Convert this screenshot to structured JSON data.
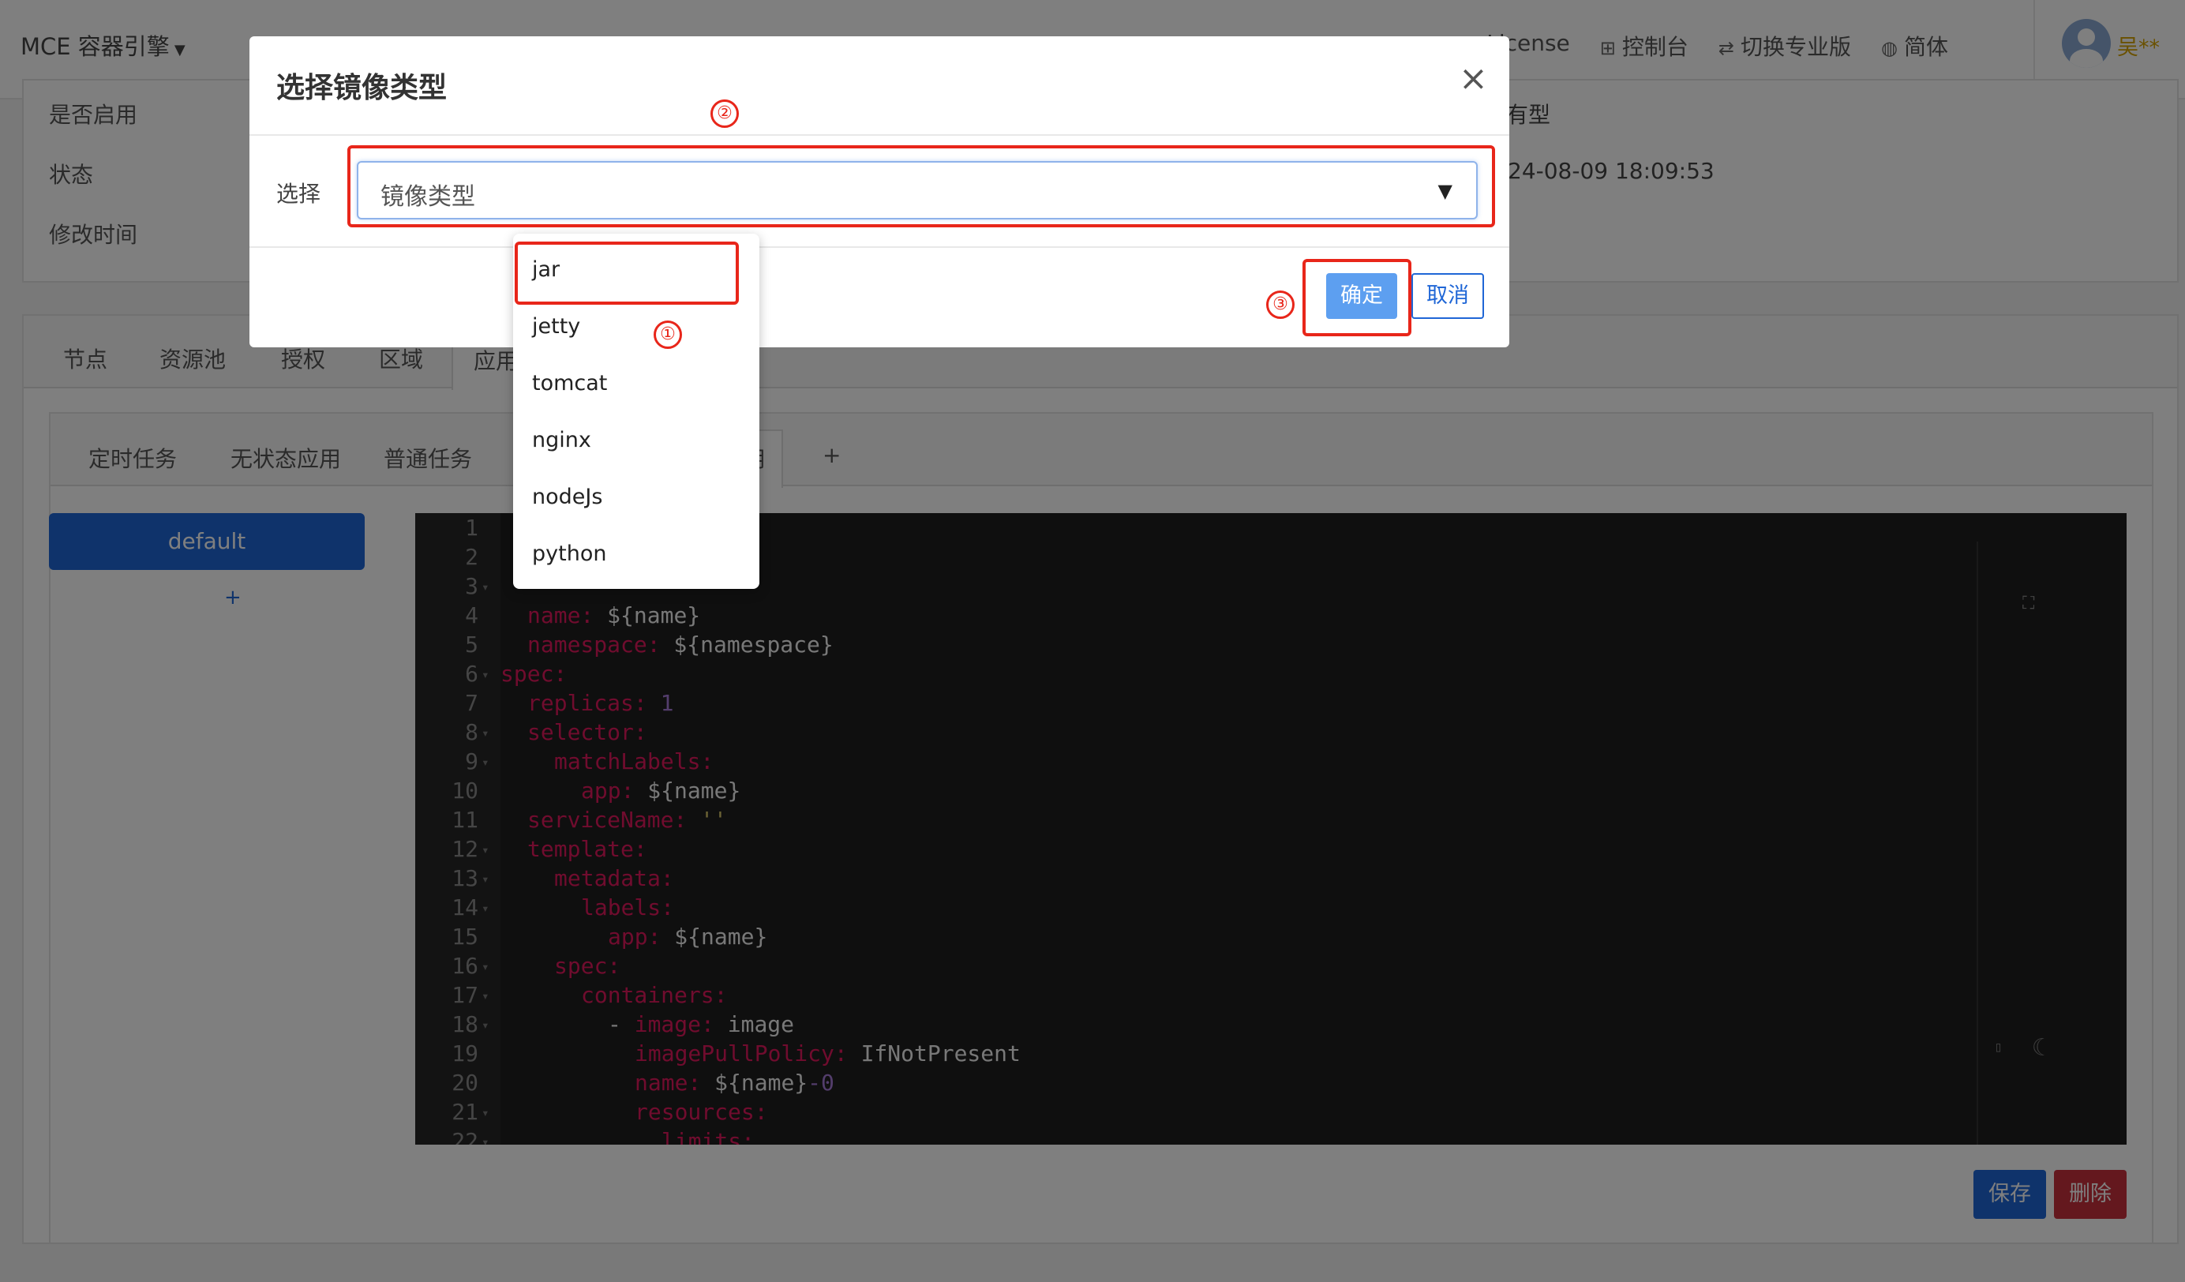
{
  "topbar": {
    "brand": "MCE 容器引擎",
    "links": [
      {
        "icon": "shield-icon",
        "label": "License"
      },
      {
        "icon": "grid-icon",
        "label": "控制台"
      },
      {
        "icon": "switch-icon",
        "label": "切换专业版"
      },
      {
        "icon": "globe-icon",
        "label": "简体"
      }
    ],
    "user": "吴**"
  },
  "info": {
    "labels": [
      "是否启用",
      "状态",
      "修改时间"
    ],
    "right_fragment_type": "有型",
    "right_fragment_time": "24-08-09 18:09:53"
  },
  "tabs": [
    "节点",
    "资源池",
    "授权",
    "区域",
    "应用"
  ],
  "subtabs": [
    "定时任务",
    "无状态应用",
    "普通任务",
    "用",
    "+"
  ],
  "sidebar": {
    "active_item": "default",
    "add": "+"
  },
  "editor": {
    "lines": [
      {
        "n": "1",
        "fold": false
      },
      {
        "n": "2",
        "fold": false
      },
      {
        "n": "3",
        "fold": true
      },
      {
        "n": "4",
        "fold": false,
        "indent": 1,
        "key": "name:",
        "val": " ${name}"
      },
      {
        "n": "5",
        "fold": false,
        "indent": 1,
        "key": "namespace:",
        "val": " ${namespace}"
      },
      {
        "n": "6",
        "fold": true,
        "indent": 0,
        "key": "spec:",
        "val": ""
      },
      {
        "n": "7",
        "fold": false,
        "indent": 1,
        "key": "replicas:",
        "num": " 1"
      },
      {
        "n": "8",
        "fold": true,
        "indent": 1,
        "key": "selector:",
        "val": ""
      },
      {
        "n": "9",
        "fold": true,
        "indent": 2,
        "key": "matchLabels:",
        "val": ""
      },
      {
        "n": "10",
        "fold": false,
        "indent": 3,
        "key": "app:",
        "val": " ${name}"
      },
      {
        "n": "11",
        "fold": false,
        "indent": 1,
        "key": "serviceName:",
        "str": " ''"
      },
      {
        "n": "12",
        "fold": true,
        "indent": 1,
        "key": "template:",
        "val": ""
      },
      {
        "n": "13",
        "fold": true,
        "indent": 2,
        "key": "metadata:",
        "val": ""
      },
      {
        "n": "14",
        "fold": true,
        "indent": 3,
        "key": "labels:",
        "val": ""
      },
      {
        "n": "15",
        "fold": false,
        "indent": 4,
        "key": "app:",
        "val": " ${name}"
      },
      {
        "n": "16",
        "fold": true,
        "indent": 2,
        "key": "spec:",
        "val": ""
      },
      {
        "n": "17",
        "fold": true,
        "indent": 3,
        "key": "containers:",
        "val": ""
      },
      {
        "n": "18",
        "fold": true,
        "indent": 4,
        "dash": "- ",
        "key": "image:",
        "val": " image"
      },
      {
        "n": "19",
        "fold": false,
        "indent": 5,
        "key": "imagePullPolicy:",
        "val": " IfNotPresent"
      },
      {
        "n": "20",
        "fold": false,
        "indent": 5,
        "key": "name:",
        "val": " ${name}",
        "num": "-0"
      },
      {
        "n": "21",
        "fold": true,
        "indent": 5,
        "key": "resources:",
        "val": ""
      },
      {
        "n": "22",
        "fold": true,
        "indent": 6,
        "key": "limits:",
        "val": ""
      }
    ]
  },
  "actions": {
    "save": "保存",
    "delete": "删除"
  },
  "modal": {
    "title": "选择镜像类型",
    "select_label": "选择",
    "select_placeholder": "镜像类型",
    "options": [
      "jar",
      "jetty",
      "tomcat",
      "nginx",
      "nodeJs",
      "python"
    ],
    "ok": "确定",
    "cancel": "取消"
  },
  "annotations": [
    "①",
    "②",
    "③"
  ]
}
